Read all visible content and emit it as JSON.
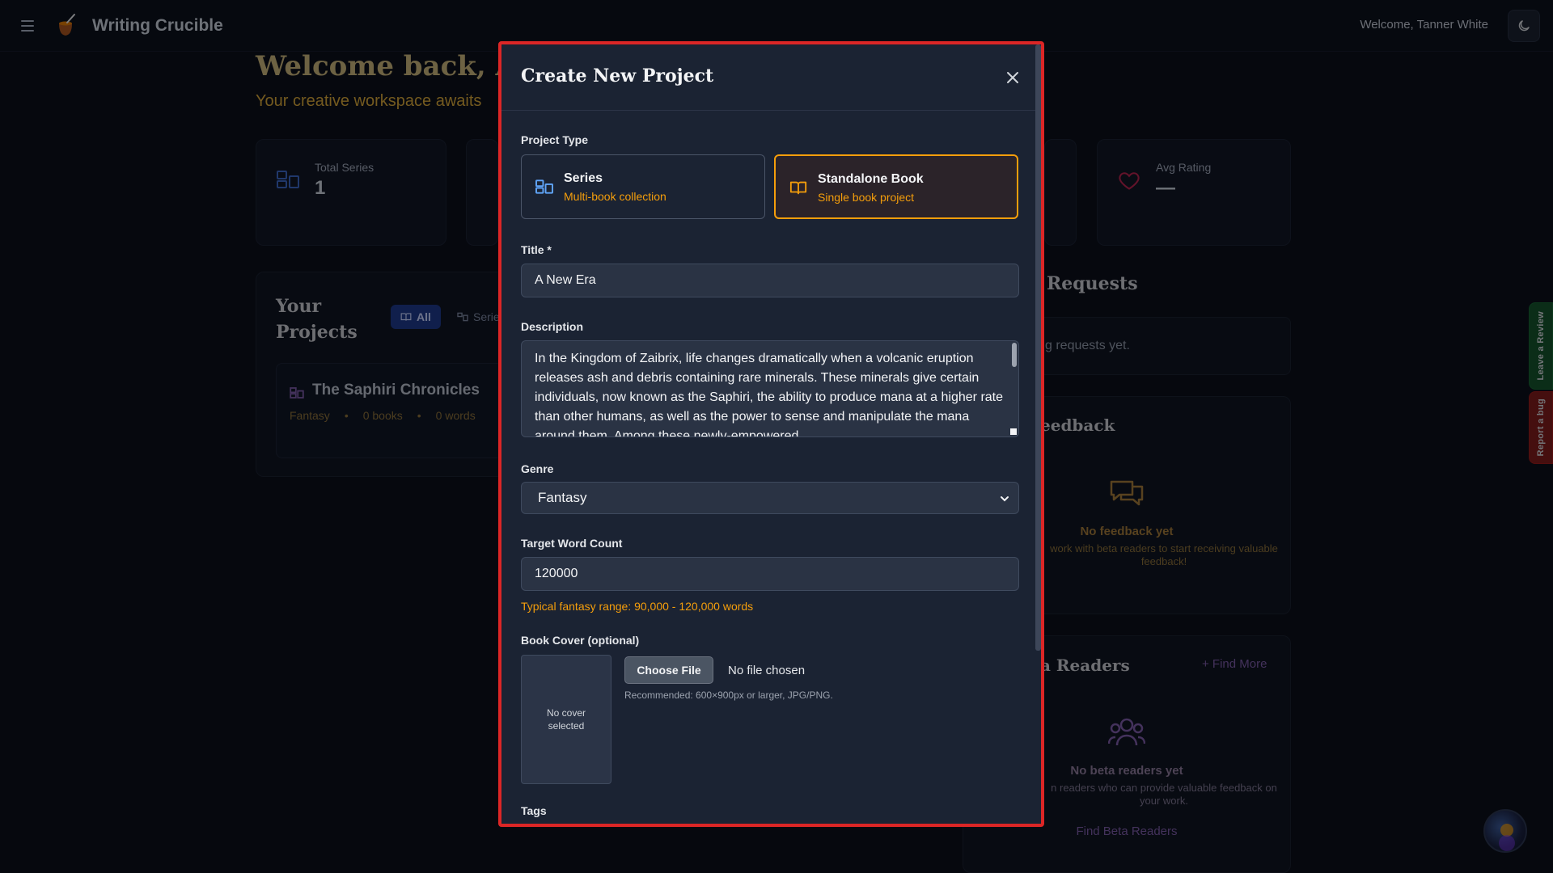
{
  "app": {
    "title": "Writing Crucible",
    "welcome_user": "Welcome, Tanner White"
  },
  "dashboard": {
    "heading": "Welcome back, Aut",
    "subheading": "Your creative workspace awaits",
    "stats": {
      "total_series_label": "Total Series",
      "total_series_value": "1",
      "avg_rating_label": "Avg Rating",
      "avg_rating_value": "—"
    },
    "projects": {
      "title": "Your Projects",
      "filter_all": "All",
      "filter_series": "Series",
      "card": {
        "name": "The Saphiri Chronicles",
        "genre": "Fantasy",
        "books": "0 books",
        "words": "0 words"
      }
    },
    "requests": {
      "title": "Requests",
      "empty": "g requests yet."
    },
    "feedback": {
      "title": "eedback",
      "empty_title": "No feedback yet",
      "empty_text": "work with beta readers to start receiving valuable feedback!"
    },
    "beta_readers": {
      "title": "a Readers",
      "find_more": "+ Find More",
      "empty_title": "No beta readers yet",
      "empty_text": "n readers who can provide valuable feedback on your work.",
      "link": "Find Beta Readers"
    },
    "side_tabs": {
      "review": "Leave a Review",
      "bug": "Report a bug"
    }
  },
  "modal": {
    "title": "Create New Project",
    "project_type_label": "Project Type",
    "types": [
      {
        "title": "Series",
        "subtitle": "Multi-book collection",
        "selected": false
      },
      {
        "title": "Standalone Book",
        "subtitle": "Single book project",
        "selected": true
      }
    ],
    "title_label": "Title *",
    "title_value": "A New Era",
    "description_label": "Description",
    "description_value": "In the Kingdom of Zaibrix, life changes dramatically when a volcanic eruption releases ash and debris containing rare minerals. These minerals give certain individuals, now known as the Saphiri, the ability to produce mana at a higher rate than other humans, as well as the power to sense and manipulate the mana around them. Among these newly-empowered",
    "genre_label": "Genre",
    "genre_value": "Fantasy",
    "word_count_label": "Target Word Count",
    "word_count_value": "120000",
    "word_count_hint": "Typical fantasy range: 90,000 - 120,000 words",
    "cover_label": "Book Cover (optional)",
    "cover_placeholder": "No cover selected",
    "choose_file": "Choose File",
    "file_status": "No file chosen",
    "file_recommendation": "Recommended: 600×900px or larger, JPG/PNG.",
    "tags_label": "Tags"
  },
  "colors": {
    "accent": "#f59e0b",
    "modal_border": "#dc2626",
    "modal_bg": "#1b2333",
    "page_bg": "#0b0f1a"
  }
}
